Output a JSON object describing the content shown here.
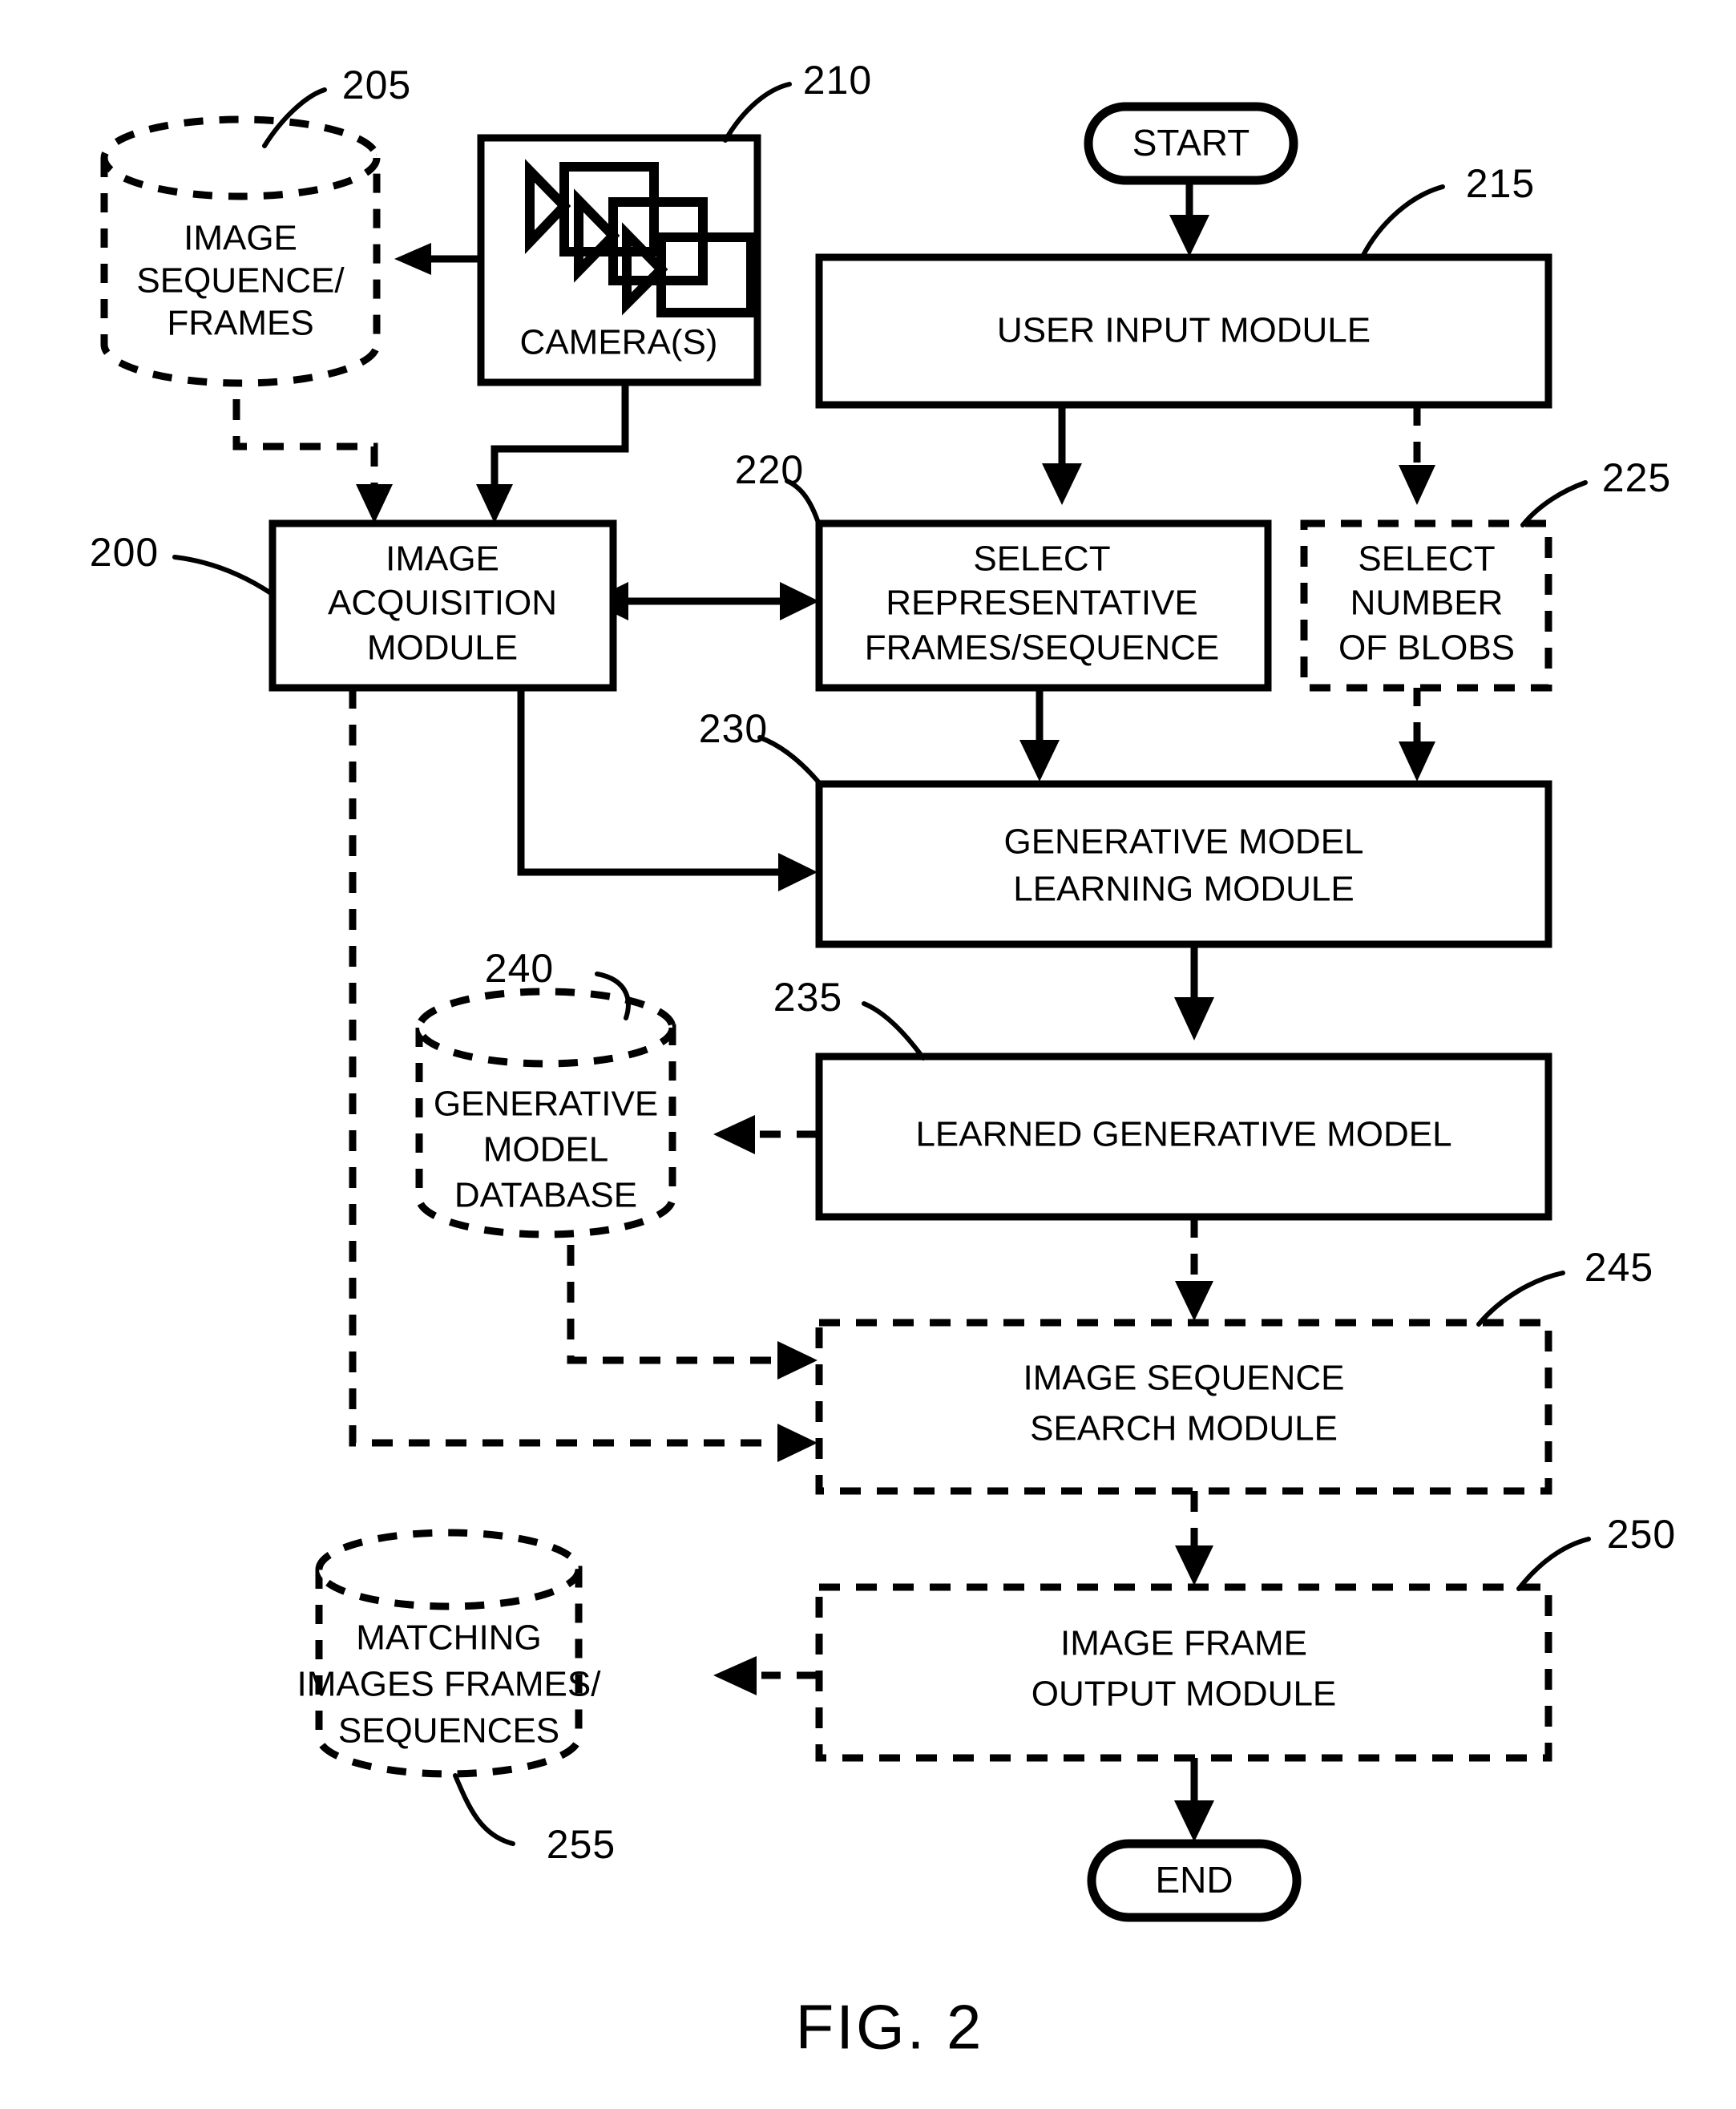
{
  "figure": {
    "caption": "FIG. 2",
    "title": "Image sequence search system block diagram"
  },
  "terminators": {
    "start": "START",
    "end": "END"
  },
  "nodes": {
    "image_sequence_frames": {
      "ref": "205",
      "lines": [
        "IMAGE",
        "SEQUENCE/",
        "FRAMES"
      ],
      "shape": "cylinder",
      "style": "dashed"
    },
    "cameras": {
      "ref": "210",
      "lines": [
        "CAMERA(S)"
      ],
      "shape": "rect",
      "style": "solid",
      "icon": "camera-stack-icon"
    },
    "user_input_module": {
      "ref": "215",
      "lines": [
        "USER INPUT MODULE"
      ],
      "shape": "rect",
      "style": "solid"
    },
    "image_acquisition_module": {
      "ref": "200",
      "lines": [
        "IMAGE",
        "ACQUISITION",
        "MODULE"
      ],
      "shape": "rect",
      "style": "solid"
    },
    "select_representative_frames": {
      "ref": "220",
      "lines": [
        "SELECT",
        "REPRESENTATIVE",
        "FRAMES/SEQUENCE"
      ],
      "shape": "rect",
      "style": "solid"
    },
    "select_number_of_blobs": {
      "ref": "225",
      "lines": [
        "SELECT",
        "NUMBER",
        "OF BLOBS"
      ],
      "shape": "rect",
      "style": "dashed"
    },
    "generative_model_learning_module": {
      "ref": "230",
      "lines": [
        "GENERATIVE MODEL",
        "LEARNING MODULE"
      ],
      "shape": "rect",
      "style": "solid"
    },
    "learned_generative_model": {
      "ref": "235",
      "lines": [
        "LEARNED GENERATIVE MODEL"
      ],
      "shape": "rect",
      "style": "solid"
    },
    "generative_model_database": {
      "ref": "240",
      "lines": [
        "GENERATIVE",
        "MODEL",
        "DATABASE"
      ],
      "shape": "cylinder",
      "style": "dashed"
    },
    "image_sequence_search_module": {
      "ref": "245",
      "lines": [
        "IMAGE SEQUENCE",
        "SEARCH MODULE"
      ],
      "shape": "rect",
      "style": "dashed"
    },
    "image_frame_output_module": {
      "ref": "250",
      "lines": [
        "IMAGE FRAME",
        "OUTPUT MODULE"
      ],
      "shape": "rect",
      "style": "dashed"
    },
    "matching_images": {
      "ref": "255",
      "lines": [
        "MATCHING",
        "IMAGES FRAMES/",
        "SEQUENCES"
      ],
      "shape": "cylinder",
      "style": "dashed"
    }
  },
  "reference_numerals": [
    "200",
    "205",
    "210",
    "215",
    "220",
    "225",
    "230",
    "235",
    "240",
    "245",
    "250",
    "255"
  ],
  "colors": {
    "ink": "#000000",
    "paper": "#ffffff"
  },
  "chart_data": {
    "type": "diagram",
    "title": "FIG. 2",
    "nodes": [
      {
        "id": "205",
        "label": "IMAGE SEQUENCE/ FRAMES",
        "shape": "cylinder",
        "style": "dashed"
      },
      {
        "id": "210",
        "label": "CAMERA(S)",
        "shape": "rect",
        "style": "solid"
      },
      {
        "id": "215",
        "label": "USER INPUT MODULE",
        "shape": "rect",
        "style": "solid"
      },
      {
        "id": "200",
        "label": "IMAGE ACQUISITION MODULE",
        "shape": "rect",
        "style": "solid"
      },
      {
        "id": "220",
        "label": "SELECT REPRESENTATIVE FRAMES/SEQUENCE",
        "shape": "rect",
        "style": "solid"
      },
      {
        "id": "225",
        "label": "SELECT NUMBER OF BLOBS",
        "shape": "rect",
        "style": "dashed"
      },
      {
        "id": "230",
        "label": "GENERATIVE MODEL LEARNING MODULE",
        "shape": "rect",
        "style": "solid"
      },
      {
        "id": "235",
        "label": "LEARNED GENERATIVE MODEL",
        "shape": "rect",
        "style": "solid"
      },
      {
        "id": "240",
        "label": "GENERATIVE MODEL DATABASE",
        "shape": "cylinder",
        "style": "dashed"
      },
      {
        "id": "245",
        "label": "IMAGE SEQUENCE SEARCH MODULE",
        "shape": "rect",
        "style": "dashed"
      },
      {
        "id": "250",
        "label": "IMAGE FRAME OUTPUT MODULE",
        "shape": "rect",
        "style": "dashed"
      },
      {
        "id": "255",
        "label": "MATCHING IMAGES FRAMES/ SEQUENCES",
        "shape": "cylinder",
        "style": "dashed"
      },
      {
        "id": "START",
        "label": "START",
        "shape": "terminator",
        "style": "solid"
      },
      {
        "id": "END",
        "label": "END",
        "shape": "terminator",
        "style": "solid"
      }
    ],
    "edges": [
      {
        "from": "210",
        "to": "205",
        "style": "solid",
        "dir": "forward"
      },
      {
        "from": "205",
        "to": "200",
        "style": "dashed",
        "dir": "forward"
      },
      {
        "from": "210",
        "to": "200",
        "style": "solid",
        "dir": "forward"
      },
      {
        "from": "START",
        "to": "215",
        "style": "solid",
        "dir": "forward"
      },
      {
        "from": "215",
        "to": "220",
        "style": "solid",
        "dir": "forward"
      },
      {
        "from": "215",
        "to": "225",
        "style": "dashed",
        "dir": "forward"
      },
      {
        "from": "200",
        "to": "220",
        "style": "solid",
        "dir": "both"
      },
      {
        "from": "220",
        "to": "230",
        "style": "solid",
        "dir": "forward"
      },
      {
        "from": "225",
        "to": "230",
        "style": "dashed",
        "dir": "forward"
      },
      {
        "from": "200",
        "to": "230",
        "style": "solid",
        "dir": "forward"
      },
      {
        "from": "230",
        "to": "235",
        "style": "solid",
        "dir": "forward"
      },
      {
        "from": "235",
        "to": "240",
        "style": "dashed",
        "dir": "forward"
      },
      {
        "from": "235",
        "to": "245",
        "style": "dashed",
        "dir": "forward"
      },
      {
        "from": "240",
        "to": "245",
        "style": "dashed",
        "dir": "forward"
      },
      {
        "from": "200",
        "to": "245",
        "style": "dashed",
        "dir": "forward"
      },
      {
        "from": "245",
        "to": "250",
        "style": "dashed",
        "dir": "forward"
      },
      {
        "from": "250",
        "to": "255",
        "style": "dashed",
        "dir": "forward"
      },
      {
        "from": "250",
        "to": "END",
        "style": "solid",
        "dir": "forward"
      }
    ]
  }
}
